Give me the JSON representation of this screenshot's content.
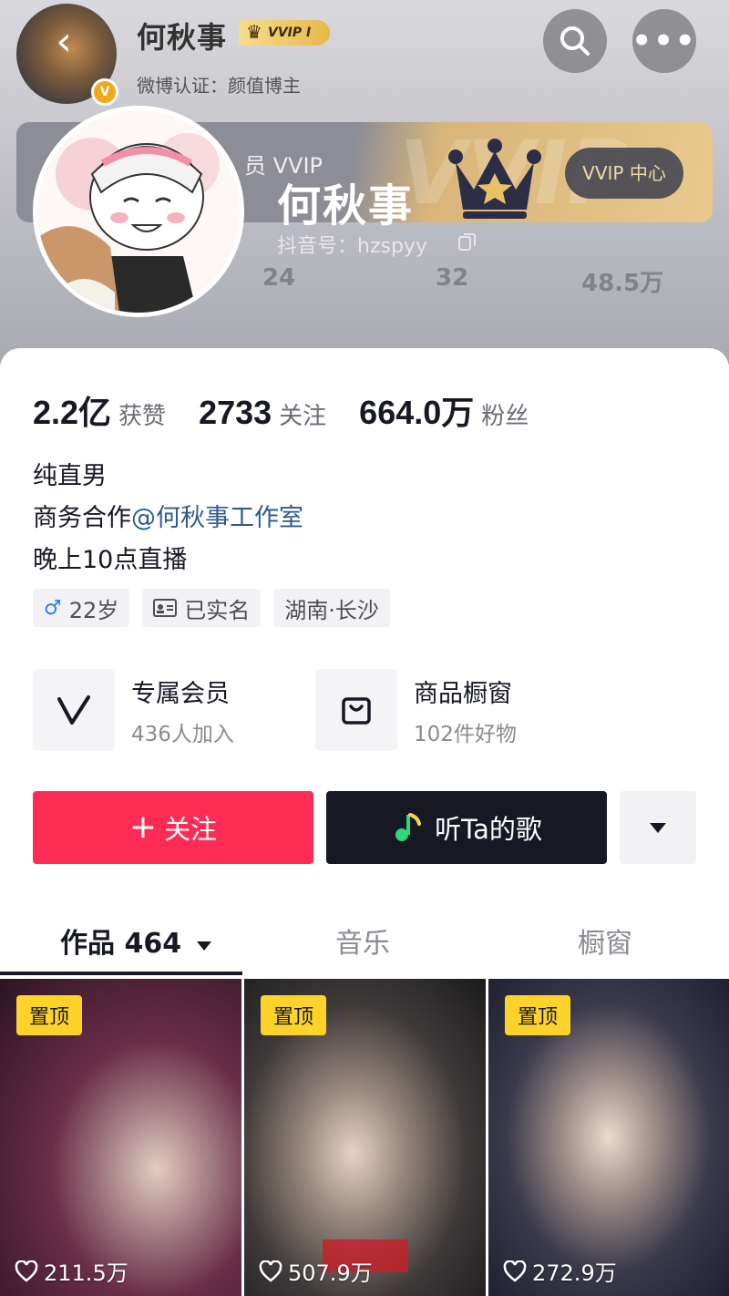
{
  "header": {
    "name": "何秋事",
    "vvip_badge": "VVIP Ⅰ",
    "certification": "微博认证：颜值博主"
  },
  "cover": {
    "vvip_card_text": "员 VVIP",
    "vvip_card_bgtext": "VVIP",
    "vvip_center_label": "VVIP 中心",
    "display_name": "何秋事",
    "douyin_id": "抖音号：hzspyy",
    "ghost_stats": [
      "24",
      "32",
      "48.5万"
    ]
  },
  "stats": [
    {
      "value": "2.2亿",
      "label": "获赞"
    },
    {
      "value": "2733",
      "label": "关注"
    },
    {
      "value": "664.0万",
      "label": "粉丝"
    }
  ],
  "bio": {
    "line1": "纯直男",
    "line2_prefix": "商务合作",
    "line2_mention": "@何秋事工作室",
    "line3": "晚上10点直播"
  },
  "tags": {
    "age": "22岁",
    "verified": "已实名",
    "location": "湖南·长沙"
  },
  "services": [
    {
      "title": "专属会员",
      "sub": "436人加入",
      "icon": "membership-v-icon"
    },
    {
      "title": "商品橱窗",
      "sub": "102件好物",
      "icon": "shopping-bag-icon"
    }
  ],
  "actions": {
    "follow": "关注",
    "music": "听Ta的歌"
  },
  "tabs": [
    {
      "label": "作品 464",
      "active": true
    },
    {
      "label": "音乐",
      "active": false
    },
    {
      "label": "橱窗",
      "active": false
    }
  ],
  "videos": [
    {
      "badge": "置顶",
      "likes": "211.5万"
    },
    {
      "badge": "置顶",
      "likes": "507.9万"
    },
    {
      "badge": "置顶",
      "likes": "272.9万"
    }
  ],
  "colors": {
    "follow": "#fe2c55",
    "music": "#161823",
    "pin": "#fdd32b",
    "mention": "#2f5b8c"
  }
}
